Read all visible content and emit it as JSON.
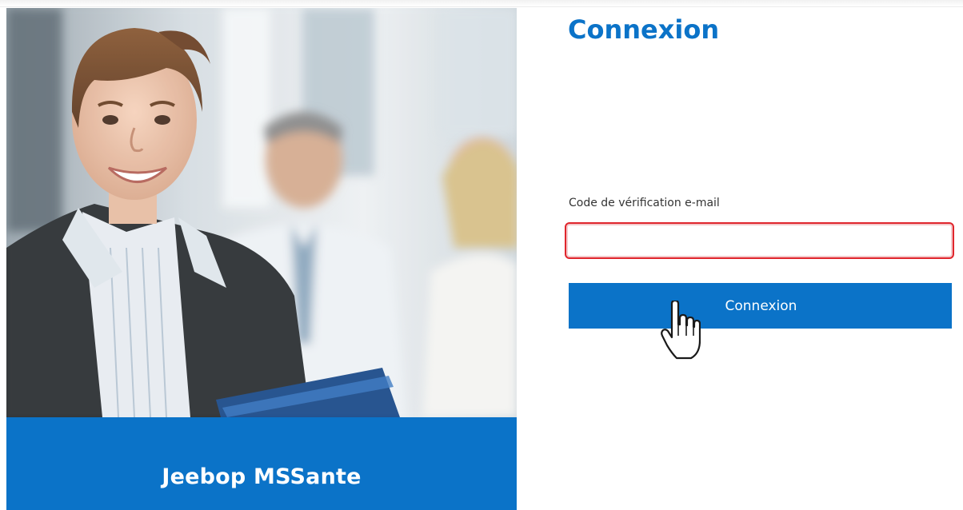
{
  "brand": {
    "name": "Jeebop MSSante",
    "primary_color": "#0b73c8"
  },
  "login": {
    "title": "Connexion",
    "code_field": {
      "label": "Code de vérification e-mail",
      "value": "",
      "placeholder": "",
      "border_color": "#e0262d"
    },
    "submit_label": "Connexion"
  },
  "cursor": {
    "icon": "hand-pointer-icon"
  },
  "hero_image": {
    "icon": "business-team-photo"
  }
}
